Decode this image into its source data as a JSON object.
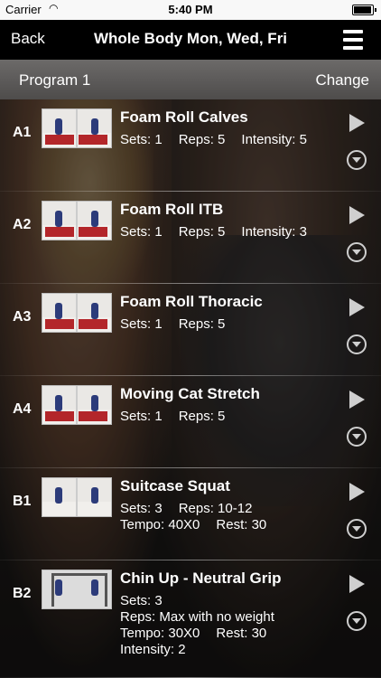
{
  "status": {
    "carrier": "Carrier",
    "time": "5:40 PM"
  },
  "nav": {
    "back": "Back",
    "title": "Whole Body Mon, Wed, Fri"
  },
  "program": {
    "name": "Program 1",
    "change": "Change"
  },
  "exercises": [
    {
      "code": "A1",
      "name": "Foam Roll Calves",
      "line1a": "Sets: 1",
      "line1b": "Reps: 5",
      "line1c": "Intensity: 5"
    },
    {
      "code": "A2",
      "name": "Foam Roll ITB",
      "line1a": "Sets: 1",
      "line1b": "Reps: 5",
      "line1c": "Intensity: 3"
    },
    {
      "code": "A3",
      "name": "Foam Roll Thoracic",
      "line1a": "Sets: 1",
      "line1b": "Reps: 5"
    },
    {
      "code": "A4",
      "name": "Moving Cat Stretch",
      "line1a": "Sets: 1",
      "line1b": "Reps: 5"
    },
    {
      "code": "B1",
      "name": "Suitcase Squat",
      "line1a": "Sets: 3",
      "line1b": "Reps: 10-12",
      "line2a": "Tempo: 40X0",
      "line2b": "Rest: 30"
    },
    {
      "code": "B2",
      "name": "Chin Up - Neutral Grip",
      "line1a": "Sets: 3",
      "line2": "Reps: Max with no weight",
      "line3a": "Tempo: 30X0",
      "line3b": "Rest: 30",
      "line4": "Intensity: 2"
    }
  ]
}
